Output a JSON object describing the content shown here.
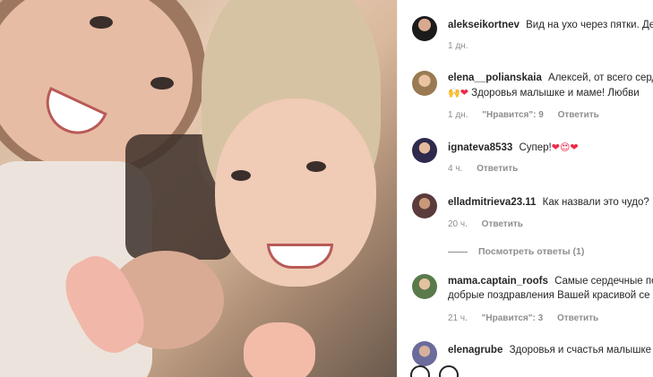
{
  "photo": {
    "alt": ""
  },
  "caption": {
    "username": "alekseikortnev",
    "text": "Вид на ухо через пятки. Дев",
    "time": "1 дн."
  },
  "comments": [
    {
      "username": "elena__polianskaia",
      "text_line1": "Алексей, от всего сердц",
      "emoji_prefix": "🙌",
      "heart": "❤",
      "text_line2": "Здоровья малышке и маме! Любви",
      "time": "1 дн.",
      "likes": "\"Нравится\": 9",
      "reply": "Ответить"
    },
    {
      "username": "ignateva8533",
      "text": "Супер!",
      "emojis": "❤😍❤",
      "time": "4 ч.",
      "reply": "Ответить"
    },
    {
      "username": "elladmitrieva23.11",
      "text": "Как назвали это чудо?",
      "time": "20 ч.",
      "reply": "Ответить",
      "view_replies": "Посмотреть ответы (1)"
    },
    {
      "username": "mama.captain_roofs",
      "text_line1": "Самые сердечные поз",
      "text_line2": "добрые поздравления Вашей красивой се",
      "time": "21 ч.",
      "likes": "\"Нравится\": 3",
      "reply": "Ответить"
    },
    {
      "username": "elenagrube",
      "text": "Здоровья и счастья малышке и"
    }
  ],
  "icons": {
    "like": "heart-outline-icon",
    "comment": "comment-bubble-icon"
  }
}
